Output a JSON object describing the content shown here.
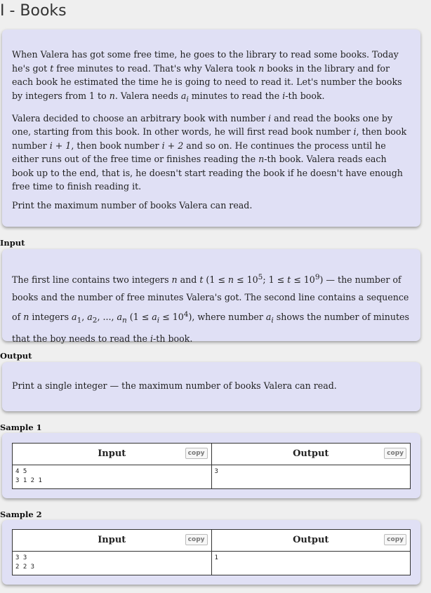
{
  "page": {
    "title": "I - Books"
  },
  "statement": {
    "p1": [
      "When Valera has got some free time, he goes to the library to read some books. Today he's got ",
      "t",
      " free minutes to read. That's why Valera took ",
      "n",
      " books in the library and for each book he estimated the time he is going to need to read it. Let's number the books by integers from 1 to ",
      "n",
      ". Valera needs ",
      "a",
      "i",
      " minutes to read the ",
      "i",
      "-th book."
    ],
    "p2": [
      "Valera decided to choose an arbitrary book with number ",
      "i",
      " and read the books one by one, starting from this book. In other words, he will first read book number ",
      "i",
      ", then book number ",
      "i + 1",
      ", then book number ",
      "i + 2",
      " and so on. He continues the process until he either runs out of the free time or finishes reading the ",
      "n",
      "-th book. Valera reads each book up to the end, that is, he doesn't start reading the book if he doesn't have enough free time to finish reading it."
    ],
    "p3": "Print the maximum number of books Valera can read."
  },
  "input_section": {
    "label": "Input",
    "text": [
      "The first line contains two integers ",
      "n",
      " and ",
      "t",
      " (1 ≤ ",
      "n",
      " ≤ 10",
      "5",
      "; 1 ≤ ",
      "t",
      " ≤ 10",
      "9",
      ") — the number of books and the number of free minutes Valera's got. The second line contains a sequence of ",
      "n",
      " integers ",
      "a",
      "1",
      ", ",
      "a",
      "2",
      ", ..., ",
      "a",
      "n",
      " (1 ≤ ",
      "a",
      "i",
      " ≤ 10",
      "4",
      "), where number ",
      "a",
      "i",
      " shows the number of minutes that the boy needs to read the ",
      "i",
      "-th book."
    ]
  },
  "output_section": {
    "label": "Output",
    "text": "Print a single integer — the maximum number of books Valera can read."
  },
  "samples": [
    {
      "label": "Sample 1",
      "input_header": "Input",
      "output_header": "Output",
      "copy_label": "copy",
      "input": "4 5\n3 1 2 1",
      "output": "3"
    },
    {
      "label": "Sample 2",
      "input_header": "Input",
      "output_header": "Output",
      "copy_label": "copy",
      "input": "3 3\n2 2 3",
      "output": "1"
    }
  ]
}
